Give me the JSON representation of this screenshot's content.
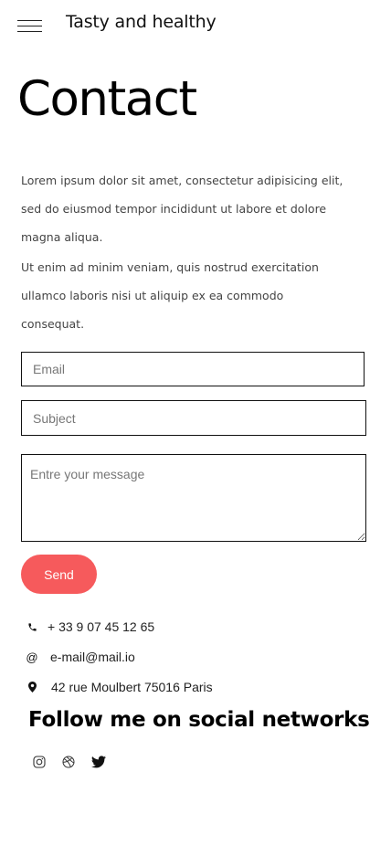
{
  "header": {
    "brand": "Tasty and healthy",
    "menu_icon": "hamburger-menu-icon"
  },
  "page": {
    "title": "Contact",
    "intro": [
      "Lorem ipsum dolor sit amet, consectetur adipisicing elit, sed do eiusmod tempor incididunt ut labore et dolore magna aliqua.",
      "Ut enim ad minim veniam, quis nostrud exercitation ullamco laboris nisi ut aliquip ex ea commodo consequat."
    ]
  },
  "form": {
    "email_placeholder": "Email",
    "subject_placeholder": "Subject",
    "message_placeholder": "Entre your message",
    "send_label": "Send",
    "send_color": "#f65a5c"
  },
  "contact": {
    "phone": "+ 33 9 07 45 12 65",
    "email_symbol": "@",
    "email": "e-mail@mail.io",
    "address": "42 rue Moulbert 75016 Paris"
  },
  "social": {
    "title": "Follow me on social networks",
    "icons": [
      "instagram-icon",
      "dribbble-icon",
      "twitter-icon"
    ]
  }
}
